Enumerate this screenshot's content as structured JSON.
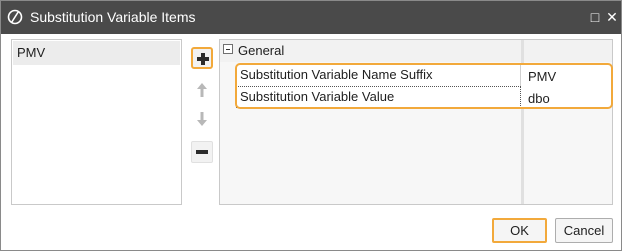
{
  "window": {
    "title": "Substitution Variable Items",
    "icon": "circle-slash-app-icon",
    "maximize_glyph": "□",
    "close_glyph": "✕"
  },
  "items": [
    "PMV"
  ],
  "side_buttons": {
    "add": "plus-icon",
    "move_up": "arrow-up-icon",
    "move_down": "arrow-down-icon",
    "remove": "minus-icon"
  },
  "property_grid": {
    "category": "General",
    "rows": [
      {
        "name": "Substitution Variable Name Suffix",
        "value": "PMV"
      },
      {
        "name": "Substitution Variable Value",
        "value": "dbo"
      }
    ]
  },
  "footer": {
    "ok_label": "OK",
    "cancel_label": "Cancel"
  },
  "colors": {
    "title_bar": "#4a4a4a",
    "focus_highlight": "#f2a93b"
  }
}
